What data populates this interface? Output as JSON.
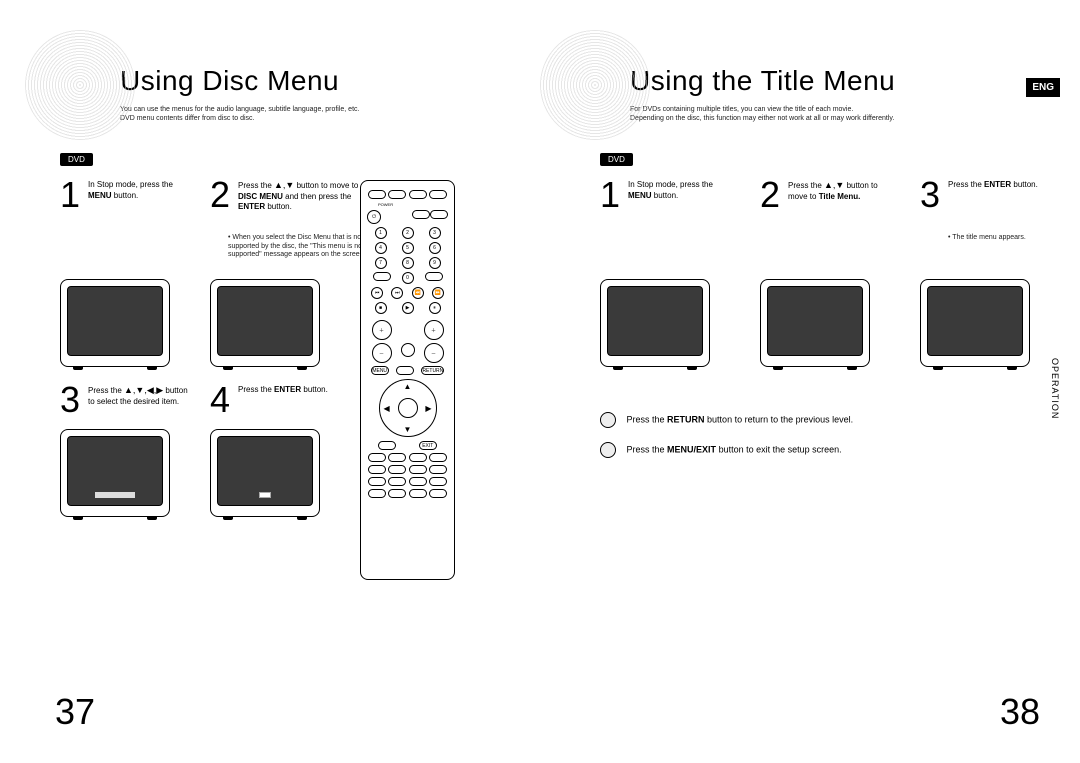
{
  "left": {
    "title": "Using Disc Menu",
    "subtitle": "You can use the menus for the audio language, subtitle language, profile, etc.\nDVD menu contents differ from disc to disc.",
    "dvd_badge": "DVD",
    "steps": {
      "s1": {
        "num": "1",
        "line1": "In Stop mode, press the",
        "bold": "MENU",
        "line2": " button."
      },
      "s2": {
        "num": "2",
        "line1": "Press the ",
        "tri": "▲,▼",
        "line2": " button to move to ",
        "bold2": "DISC MENU",
        "line3": " and then press the ",
        "bold3": "ENTER",
        "line4": " button."
      },
      "s2_note": "• When you select the Disc Menu that is not supported by the disc, the \"This menu is not supported\" message appears on the screen.",
      "s3": {
        "num": "3",
        "line1": "Press the ",
        "tri": "▲,▼,◀,▶",
        "line2": " button to select the desired item."
      },
      "s4": {
        "num": "4",
        "line1": "Press the ",
        "bold": "ENTER",
        "line2": " button."
      }
    },
    "page_num": "37"
  },
  "right": {
    "title": "Using the Title Menu",
    "subtitle": "For DVDs containing multiple titles, you can view the title of each movie.\nDepending on the disc, this function may either not work at all or may work differently.",
    "lang": "ENG",
    "op_tab": "OPERATION",
    "dvd_badge": "DVD",
    "steps": {
      "s1": {
        "num": "1",
        "line1": "In Stop mode, press the",
        "bold": "MENU",
        "line2": " button."
      },
      "s2": {
        "num": "2",
        "line1": "Press the ",
        "tri": "▲,▼",
        "line2": " button to move to ",
        "bold2": "Title Menu."
      },
      "s3": {
        "num": "3",
        "line1": "Press the ",
        "bold": "ENTER",
        "line2": " button."
      },
      "s3_note": "• The title menu appears."
    },
    "footers": {
      "f1_pre": "Press the ",
      "f1_bold": "RETURN",
      "f1_post": " button to return to the previous level.",
      "f2_pre": "Press the ",
      "f2_bold": "MENU/EXIT",
      "f2_post": " button to exit the setup screen."
    },
    "page_num": "38"
  }
}
